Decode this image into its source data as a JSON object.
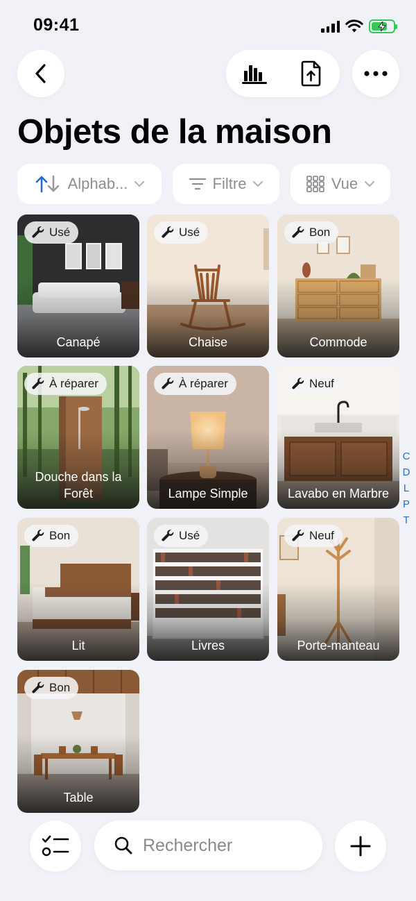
{
  "status_bar": {
    "time": "09:41"
  },
  "header": {
    "title": "Objets de la maison"
  },
  "toolbar": {
    "back_icon": "chevron-left-icon",
    "stats_icon": "bar-chart-icon",
    "export_icon": "document-upload-icon",
    "more_icon": "ellipsis-icon"
  },
  "filters": {
    "sort_label": "Alphab...",
    "filter_label": "Filtre",
    "view_label": "Vue"
  },
  "items": [
    {
      "name": "Canapé",
      "condition": "Usé"
    },
    {
      "name": "Chaise",
      "condition": "Usé"
    },
    {
      "name": "Commode",
      "condition": "Bon"
    },
    {
      "name": "Douche dans la Forêt",
      "condition": "À réparer"
    },
    {
      "name": "Lampe Simple",
      "condition": "À réparer"
    },
    {
      "name": "Lavabo en Marbre",
      "condition": "Neuf"
    },
    {
      "name": "Lit",
      "condition": "Bon"
    },
    {
      "name": "Livres",
      "condition": "Usé"
    },
    {
      "name": "Porte-manteau",
      "condition": "Neuf"
    },
    {
      "name": "Table",
      "condition": "Bon"
    }
  ],
  "index_letters": [
    "C",
    "D",
    "L",
    "P",
    "T"
  ],
  "bottom_bar": {
    "search_placeholder": "Rechercher",
    "checklist_icon": "checklist-icon",
    "add_icon": "plus-icon"
  },
  "colors": {
    "accent": "#1f6fd0",
    "background": "#f1f2f7",
    "battery": "#34c759"
  }
}
